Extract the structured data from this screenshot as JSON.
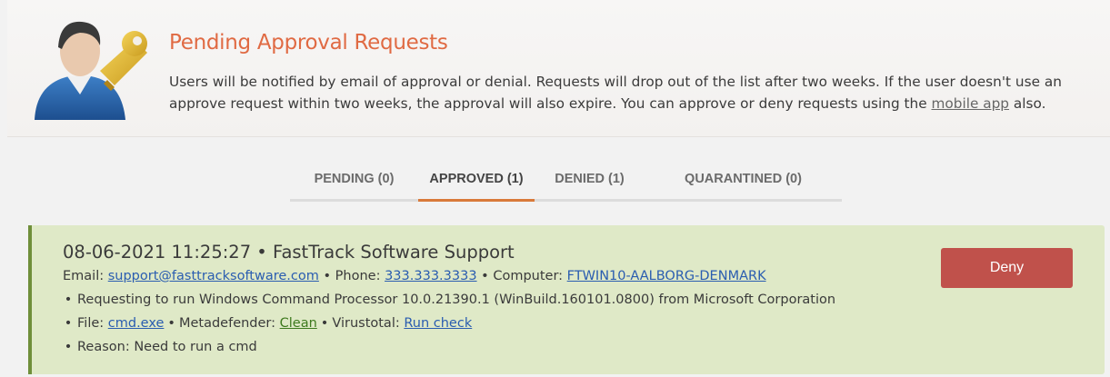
{
  "header": {
    "title": "Pending Approval Requests",
    "description": "Users will be notified by email of approval or denial. Requests will drop out of the list after two weeks. If the user doesn't use an approve request within two weeks, the approval will also expire. You can approve or deny requests using the ",
    "mobile_link": "mobile app",
    "description_end": " also.",
    "avatar_icon": "user-key-icon"
  },
  "tabs": [
    {
      "label": "PENDING (0)",
      "active": false
    },
    {
      "label": "APPROVED (1)",
      "active": true
    },
    {
      "label": "DENIED (1)",
      "active": false
    },
    {
      "label": "QUARANTINED (0)",
      "active": false
    }
  ],
  "request": {
    "timestamp": "08-06-2021 11:25:27",
    "separator": " • ",
    "requester": "FastTrack Software Support",
    "email_label": "Email: ",
    "email": "support@fasttracksoftware.com",
    "phone_label": " • Phone: ",
    "phone": "333.333.3333",
    "computer_label": " • Computer: ",
    "computer": "FTWIN10-AALBORG-DENMARK",
    "details": "Requesting to run Windows Command Processor 10.0.21390.1 (WinBuild.160101.0800) from Microsoft Corporation",
    "file_label": "File: ",
    "file": "cmd.exe",
    "metadefender_label": "Metadefender: ",
    "metadefender": "Clean",
    "virustotal_label": "Virustotal: ",
    "virustotal": "Run check",
    "reason": "Reason: Need to run a cmd",
    "deny_label": "Deny",
    "status_color": "#dfe9c7",
    "deny_color": "#c0514b"
  }
}
